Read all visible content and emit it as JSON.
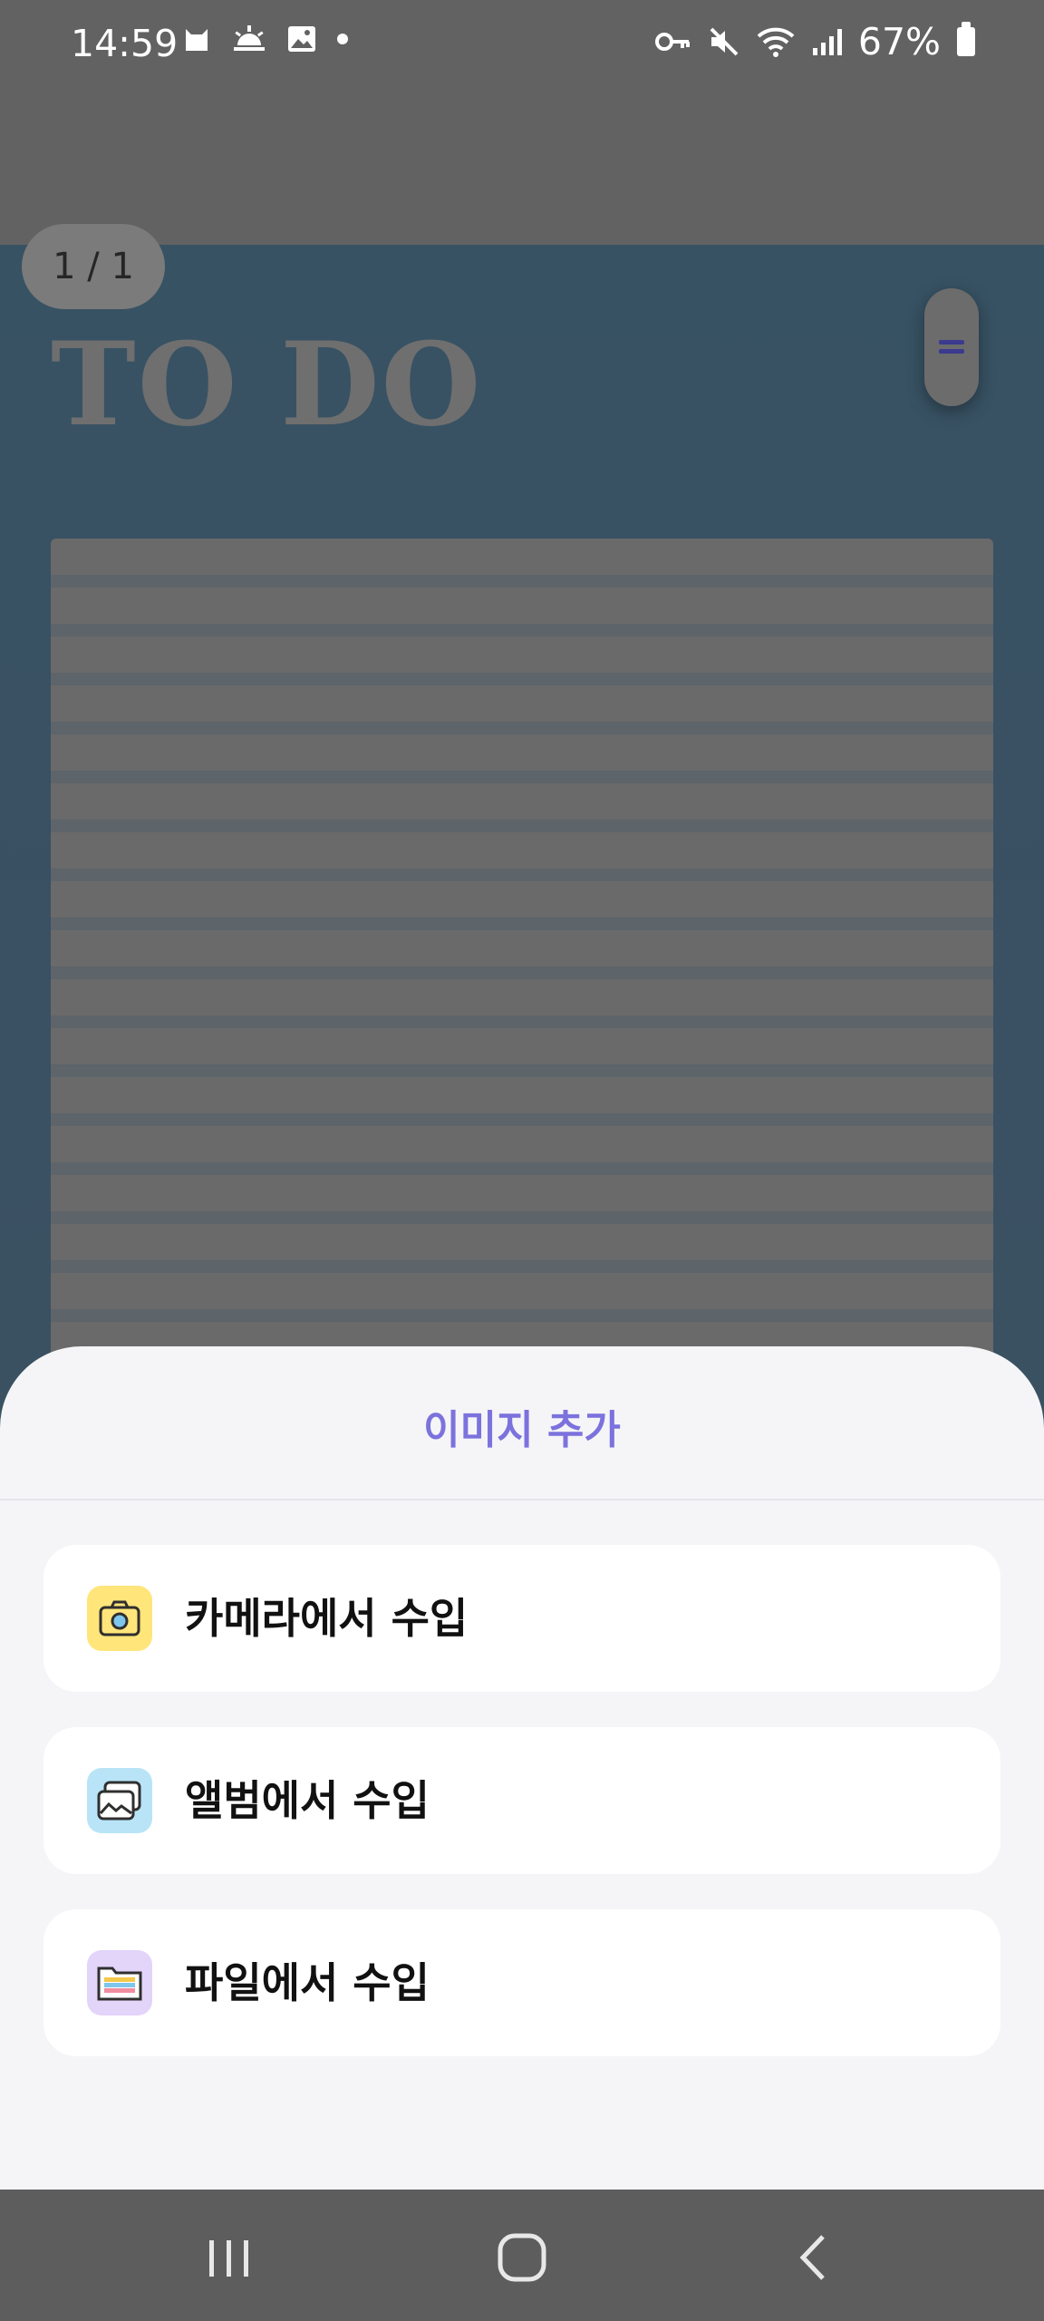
{
  "status_bar": {
    "time": "14:59",
    "battery": "67%",
    "left_icons": [
      "cat-icon",
      "sunrise-icon",
      "image-icon",
      "dot-icon"
    ],
    "right_icons": [
      "key-icon",
      "mute-icon",
      "wifi-icon",
      "signal-icon",
      "battery-icon"
    ]
  },
  "background_app": {
    "page_counter": "1 / 1",
    "title": "TO DO",
    "menu_handle_icon": "menu-handle-icon"
  },
  "sheet": {
    "title": "이미지 추가",
    "options": [
      {
        "label": "카메라에서 수입",
        "icon": "camera-icon",
        "icon_bg": "#FFE57A"
      },
      {
        "label": "앨범에서 수입",
        "icon": "album-icon",
        "icon_bg": "#B9E4F8"
      },
      {
        "label": "파일에서 수입",
        "icon": "folder-icon",
        "icon_bg": "#E3D4FA"
      }
    ]
  },
  "nav_bar": {
    "buttons": [
      "recent-apps",
      "home",
      "back"
    ]
  },
  "colors": {
    "accent": "#7C72DD",
    "sheet_bg": "#F5F5F8",
    "scrim": "#626262"
  }
}
